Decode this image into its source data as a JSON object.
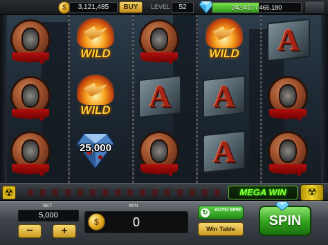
{
  "topbar": {
    "coins": "3,121,485",
    "buy_label": "BUY",
    "level_label": "LEVEL",
    "level": "52",
    "xp_text": "242,417 / 465,180",
    "xp_fraction": 0.52
  },
  "reels": {
    "rows": [
      [
        "O",
        "WILD",
        "O",
        "WILD",
        "A"
      ],
      [
        "O",
        "WILD",
        "A",
        "A",
        "O"
      ],
      [
        "O",
        "25000",
        "O",
        "A",
        "O"
      ]
    ],
    "wild_label": "WILD",
    "diamond_prize": "25,000"
  },
  "strip": {
    "mega_win_label": "MEGA WIN"
  },
  "panel": {
    "bet_label": "BET",
    "bet_value": "5,000",
    "minus_label": "−",
    "plus_label": "+",
    "win_label": "WIN",
    "win_value": "0",
    "auto_spin_label": "AUTO SPIN",
    "win_table_label": "Win Table",
    "spin_label": "SPIN"
  },
  "colors": {
    "accent_gold": "#e0a419",
    "accent_green": "#2fa11c",
    "xp_green": "#5fd04a",
    "blood_red": "#a52615"
  }
}
